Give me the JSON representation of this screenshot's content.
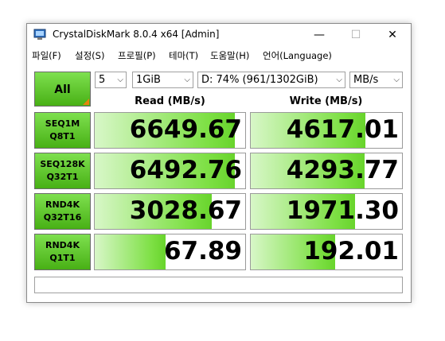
{
  "window": {
    "title": "CrystalDiskMark 8.0.4 x64 [Admin]",
    "controls": {
      "minimize": "—",
      "maximize": "☐",
      "close": "✕"
    }
  },
  "menu": [
    "파일(F)",
    "설정(S)",
    "프로필(P)",
    "테마(T)",
    "도움말(H)",
    "언어(Language)"
  ],
  "toolbar": {
    "all_label": "All",
    "count": "5",
    "size": "1GiB",
    "drive": "D: 74% (961/1302GiB)",
    "unit": "MB/s"
  },
  "headers": {
    "read": "Read (MB/s)",
    "write": "Write (MB/s)"
  },
  "colors": {
    "accent_green": "#48b015",
    "corner_orange": "#e8820c"
  },
  "rows": [
    {
      "line1": "SEQ1M",
      "line2": "Q8T1",
      "read": "6649.67",
      "write": "4617.01",
      "read_fill": 0.93,
      "write_fill": 0.76
    },
    {
      "line1": "SEQ128K",
      "line2": "Q32T1",
      "read": "6492.76",
      "write": "4293.77",
      "read_fill": 0.93,
      "write_fill": 0.75
    },
    {
      "line1": "RND4K",
      "line2": "Q32T16",
      "read": "3028.67",
      "write": "1971.30",
      "read_fill": 0.78,
      "write_fill": 0.69
    },
    {
      "line1": "RND4K",
      "line2": "Q1T1",
      "read": "67.89",
      "write": "192.01",
      "read_fill": 0.47,
      "write_fill": 0.56
    }
  ],
  "status": ""
}
